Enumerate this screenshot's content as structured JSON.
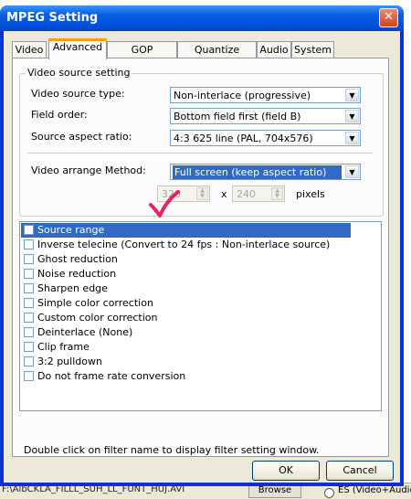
{
  "window": {
    "title": "MPEG Setting"
  },
  "tabs": [
    {
      "label": "Video",
      "active": false
    },
    {
      "label": "Advanced",
      "active": true
    },
    {
      "label": "GOP structure",
      "active": false
    },
    {
      "label": "Quantize matrix",
      "active": false
    },
    {
      "label": "Audio",
      "active": false
    },
    {
      "label": "System",
      "active": false
    }
  ],
  "video_source": {
    "group_label": "Video source setting",
    "fields": [
      {
        "label": "Video source type:",
        "value": "Non-interlace (progressive)"
      },
      {
        "label": "Field order:",
        "value": "Bottom field first (field B)"
      },
      {
        "label": "Source aspect ratio:",
        "value": "4:3 625 line (PAL, 704x576)"
      }
    ],
    "arrange": {
      "label": "Video arrange Method:",
      "value": "Full screen (keep aspect ratio)"
    },
    "width": "320",
    "x_label": "x",
    "height": "240",
    "pixels_label": "pixels"
  },
  "filters": [
    {
      "label": "Source range",
      "checked": false,
      "selected": true
    },
    {
      "label": "Inverse telecine (Convert to 24 fps : Non-interlace source)",
      "checked": false,
      "selected": false
    },
    {
      "label": "Ghost reduction",
      "checked": false,
      "selected": false
    },
    {
      "label": "Noise reduction",
      "checked": false,
      "selected": false
    },
    {
      "label": "Sharpen edge",
      "checked": false,
      "selected": false
    },
    {
      "label": "Simple color correction",
      "checked": false,
      "selected": false
    },
    {
      "label": "Custom color correction",
      "checked": false,
      "selected": false
    },
    {
      "label": "Deinterlace (None)",
      "checked": false,
      "selected": false
    },
    {
      "label": "Clip frame",
      "checked": false,
      "selected": false
    },
    {
      "label": "3:2 pulldown",
      "checked": false,
      "selected": false
    },
    {
      "label": "Do not frame rate conversion",
      "checked": false,
      "selected": false
    }
  ],
  "hint": "Double click on filter name to display filter setting window.",
  "buttons": {
    "ok": "OK",
    "cancel": "Cancel"
  },
  "background": {
    "file_fragment": "F:\\AlbCKLA_FILLL_SUH_LL_FUNT_HUJ.AVI",
    "browse": "Browse",
    "radio_label": "ES (Video+Audio"
  },
  "colors": {
    "selection": "#316ac5",
    "titlebar": "#0054e3",
    "annotation": "#e8245f"
  }
}
